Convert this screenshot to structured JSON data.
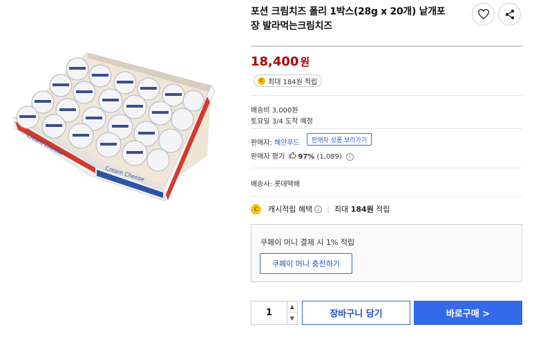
{
  "product": {
    "title": "포션 크림치즈 폴리 1박스(28g x 20개) 낱개포장 발라먹는크림치즈",
    "price": "18,400",
    "currency": "원",
    "reward_label": "최대 184원 적립"
  },
  "actions": {
    "wish_icon": "heart-icon",
    "share_icon": "share-icon"
  },
  "shipping": {
    "fee": "배송비 3,000원",
    "arrival": "토요일 3/4 도착 예정"
  },
  "seller": {
    "label": "판매자: ",
    "name": "혜안푸드",
    "view_items_label": "판매자 상품 보러가기",
    "rating_label": "판매자 평가",
    "rating_percent": "97%",
    "rating_count": "(1,089)"
  },
  "carrier": "배송사: 롯데택배",
  "cash": {
    "label": "캐시적립 혜택",
    "max_label": "최대",
    "amount": "184원",
    "suffix": "적립"
  },
  "coupay": {
    "text": "쿠페이 머니 결제 시 1% 적립",
    "charge_label": "쿠페이 머니 충전하기"
  },
  "purchase": {
    "quantity": "1",
    "cart_label": "장바구니 담기",
    "buy_label": "바로구매 >"
  },
  "colors": {
    "price": "#ae0000",
    "accent": "#346aea",
    "coin": "#f6c600"
  }
}
